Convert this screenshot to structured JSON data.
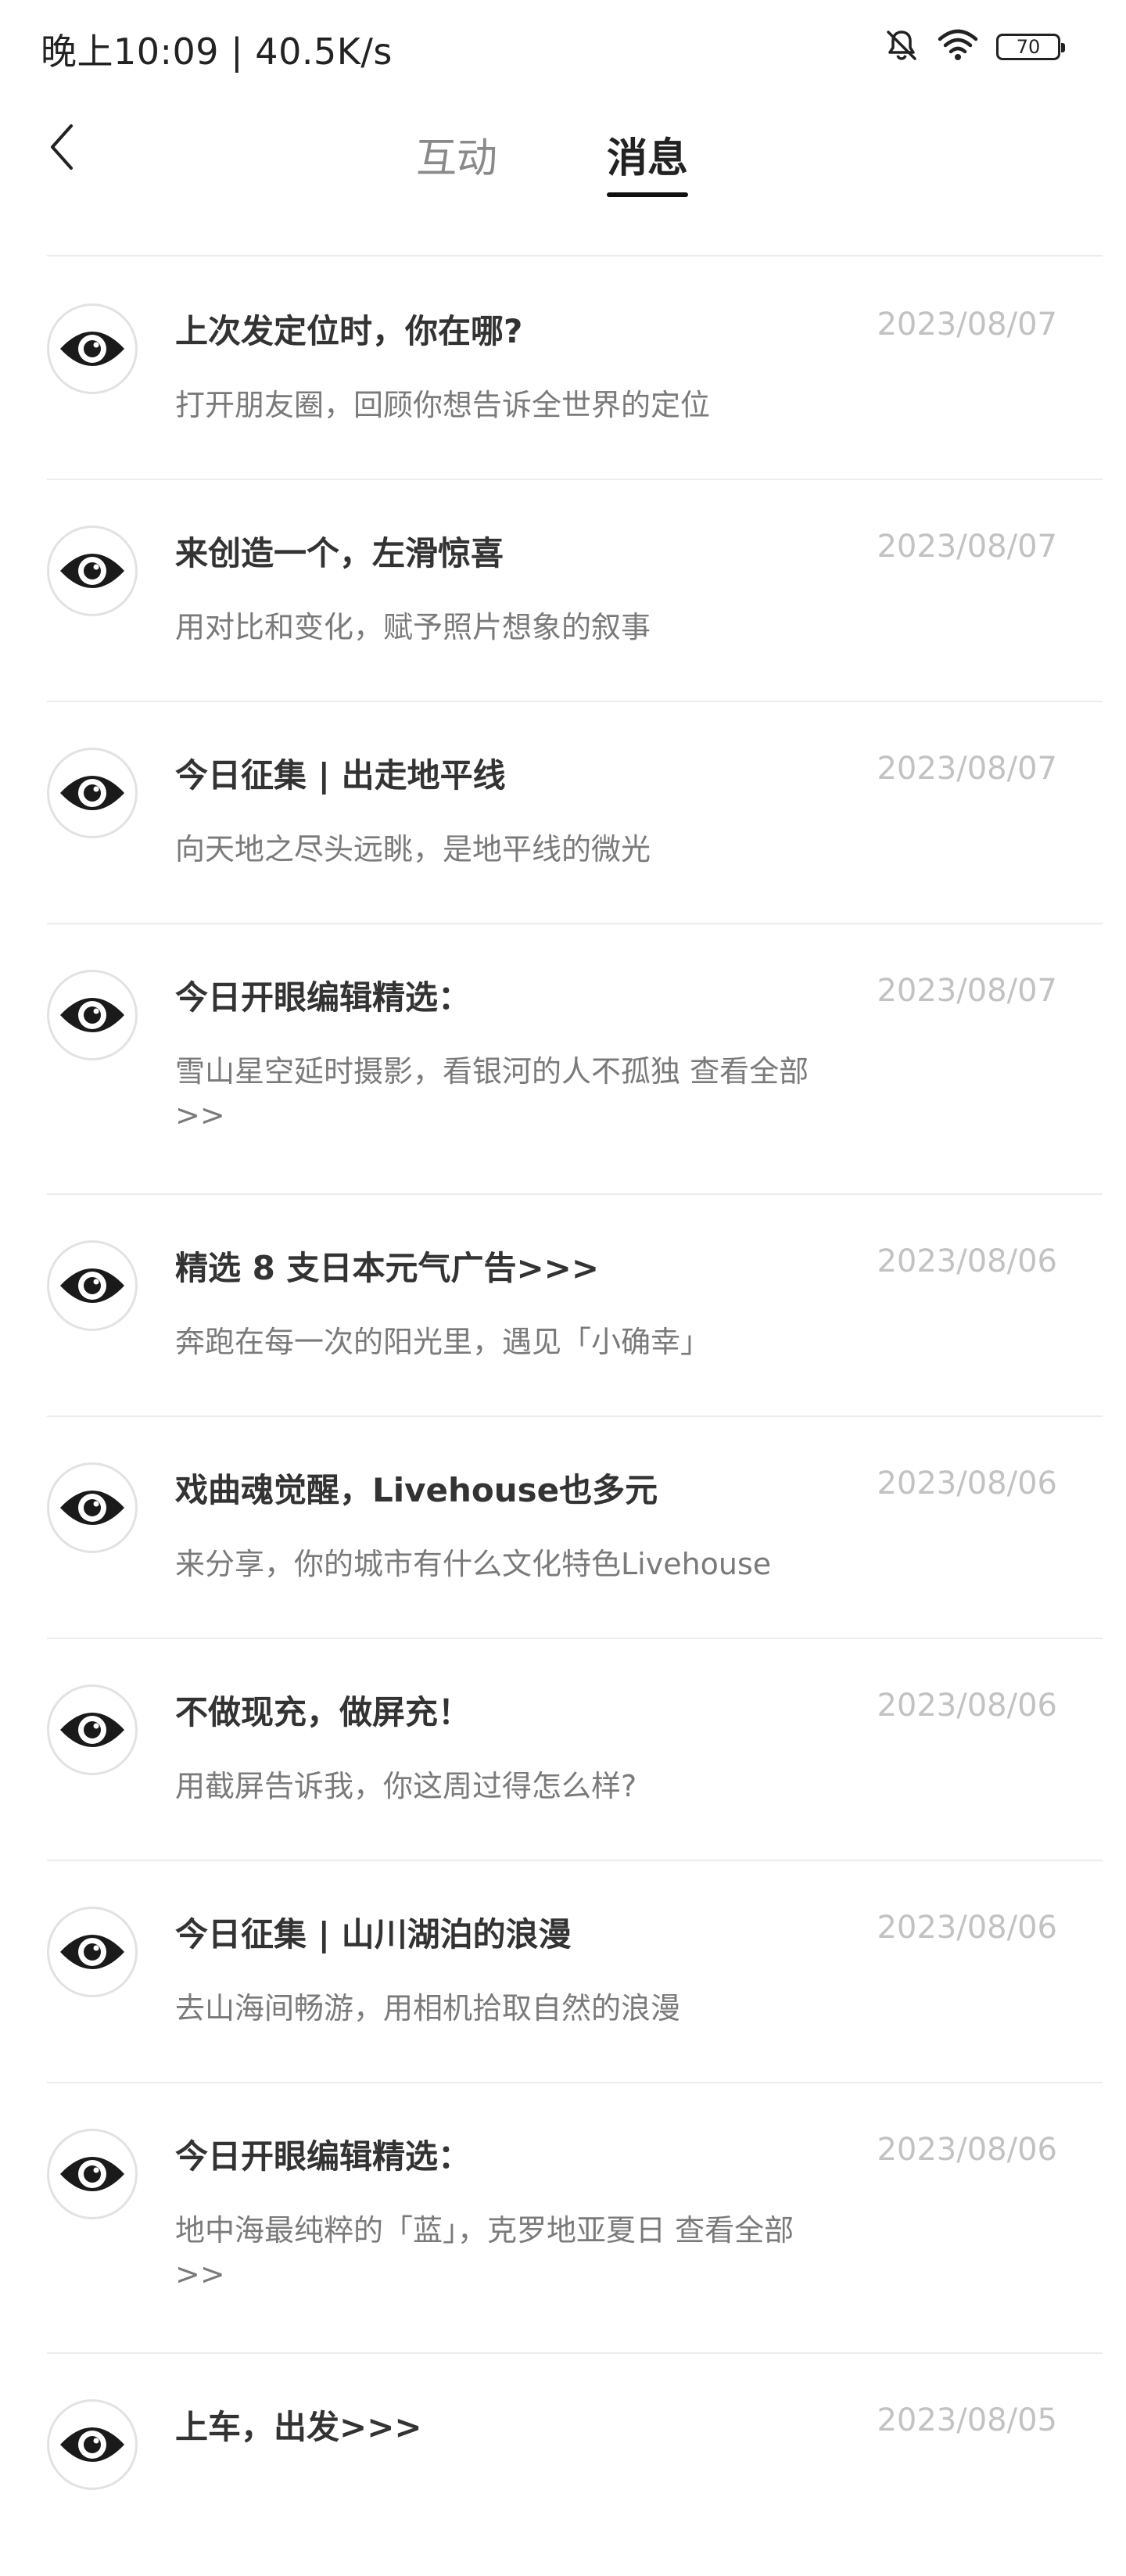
{
  "status_bar": {
    "time_speed": "晚上10:09 | 40.5K/s",
    "battery_level": "70",
    "icons": [
      "bell-muted-icon",
      "wifi-icon",
      "battery-icon"
    ]
  },
  "header": {
    "back_icon": "chevron-left-icon",
    "tabs": [
      {
        "label": "互动",
        "active": false
      },
      {
        "label": "消息",
        "active": true
      }
    ]
  },
  "colors": {
    "title_text": "#333333",
    "preview_text": "#7a7a7a",
    "date_text": "#c2c2c2",
    "divider": "#ececec",
    "active_tab_underline": "#111111",
    "inactive_tab": "#8a8a8a"
  },
  "messages": [
    {
      "icon": "eye-icon",
      "title": "上次发定位时，你在哪?",
      "date": "2023/08/07",
      "preview": "打开朋友圈，回顾你想告诉全世界的定位"
    },
    {
      "icon": "eye-icon",
      "title": "来创造一个，左滑惊喜",
      "date": "2023/08/07",
      "preview": "用对比和变化，赋予照片想象的叙事"
    },
    {
      "icon": "eye-icon",
      "title": "今日征集 | 出走地平线",
      "date": "2023/08/07",
      "preview": "向天地之尽头远眺，是地平线的微光"
    },
    {
      "icon": "eye-icon",
      "title": "今日开眼编辑精选：",
      "date": "2023/08/07",
      "preview": "雪山星空延时摄影，看银河的人不孤独 查看全部>>"
    },
    {
      "icon": "eye-icon",
      "title": "精选 8 支日本元气广告>>>",
      "date": "2023/08/06",
      "preview": "奔跑在每一次的阳光里，遇见「小确幸」"
    },
    {
      "icon": "eye-icon",
      "title": "戏曲魂觉醒，Livehouse也多元",
      "date": "2023/08/06",
      "preview": "来分享，你的城市有什么文化特色Livehouse"
    },
    {
      "icon": "eye-icon",
      "title": "不做现充，做屏充！",
      "date": "2023/08/06",
      "preview": "用截屏告诉我，你这周过得怎么样?"
    },
    {
      "icon": "eye-icon",
      "title": "今日征集 | 山川湖泊的浪漫",
      "date": "2023/08/06",
      "preview": "去山海间畅游，用相机拾取自然的浪漫"
    },
    {
      "icon": "eye-icon",
      "title": "今日开眼编辑精选：",
      "date": "2023/08/06",
      "preview": "地中海最纯粹的「蓝」，克罗地亚夏日 查看全部>>"
    },
    {
      "icon": "eye-icon",
      "title": "上车，出发>>>",
      "date": "2023/08/05",
      "preview": ""
    }
  ]
}
